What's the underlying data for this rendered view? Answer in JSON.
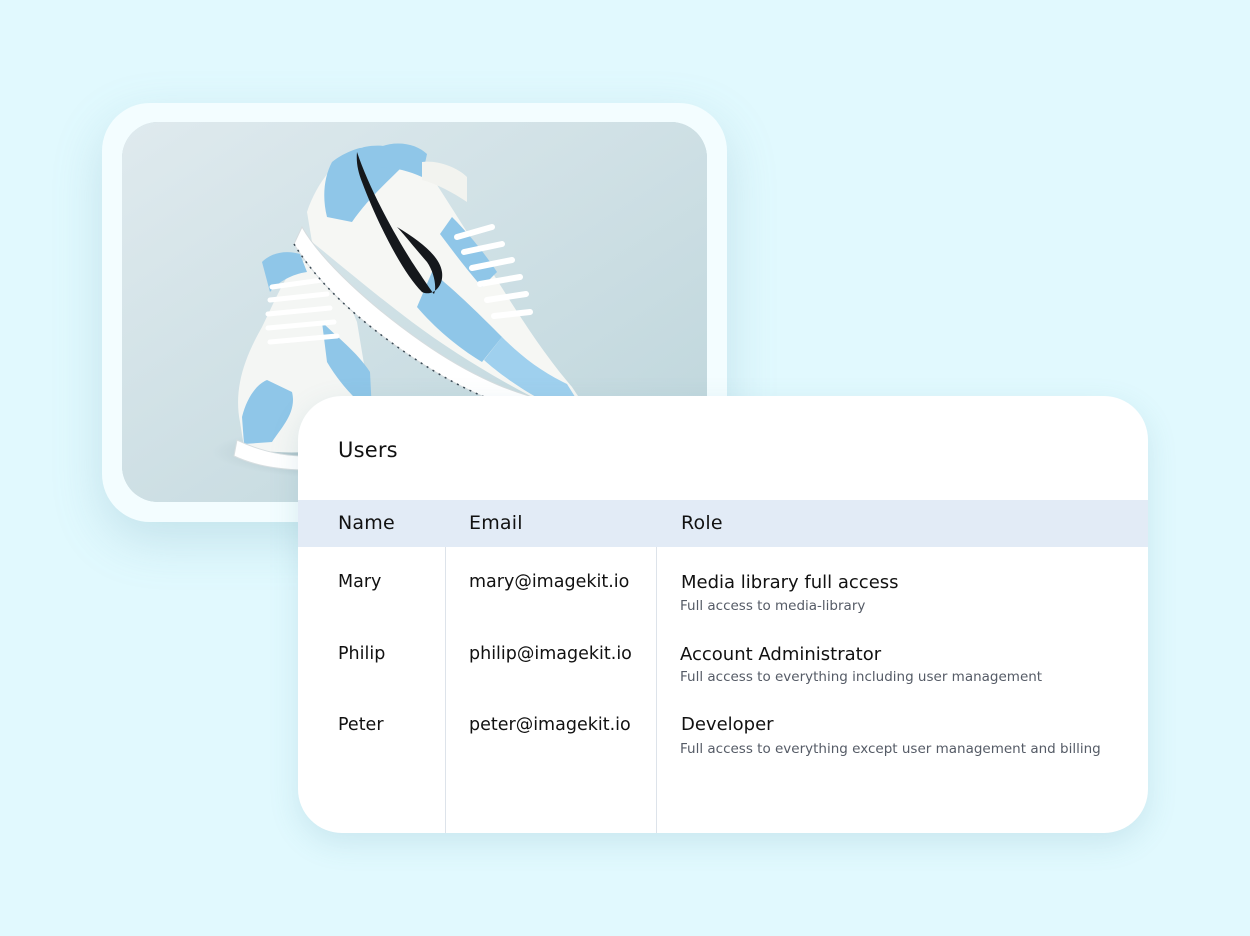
{
  "image_card": {
    "image_alt": "Pair of light blue and white Nike sneakers"
  },
  "users_panel": {
    "title": "Users",
    "columns": {
      "name": "Name",
      "email": "Email",
      "role": "Role"
    },
    "rows": [
      {
        "name": "Mary",
        "email": "mary@imagekit.io",
        "role_title": "Media library full access",
        "role_desc": "Full access to media-library"
      },
      {
        "name": "Philip",
        "email": "philip@imagekit.io",
        "role_title": "Account Administrator",
        "role_desc": "Full access to everything including user management"
      },
      {
        "name": "Peter",
        "email": "peter@imagekit.io",
        "role_title": "Developer",
        "role_desc": "Full access to everything except user management and billing"
      }
    ]
  },
  "colors": {
    "page_background": "#e1f9fe",
    "table_header_background": "#e2ebf6",
    "sneaker_blue": "#8fc6e8",
    "card_background": "#ffffff"
  }
}
